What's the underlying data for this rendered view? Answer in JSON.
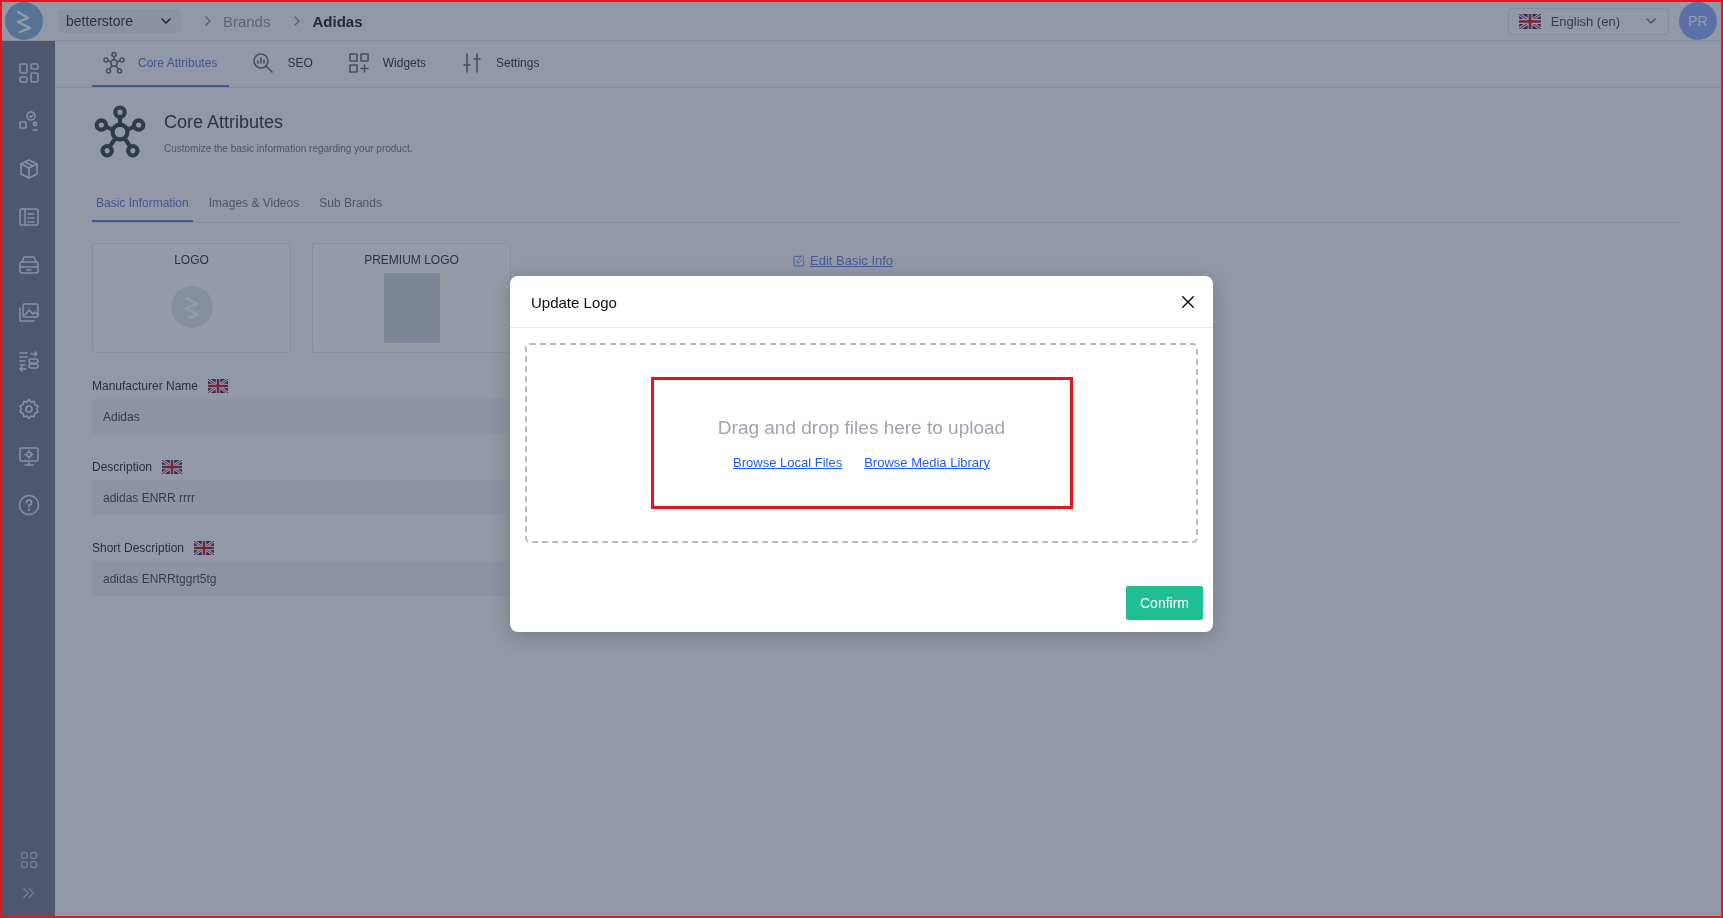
{
  "top_bar": {
    "store": "betterstore",
    "breadcrumb": [
      {
        "label": "Brands",
        "current": false
      },
      {
        "label": "Adidas",
        "current": true
      }
    ],
    "language": "English (en)",
    "avatar": "PR"
  },
  "tabs": [
    {
      "label": "Core Attributes",
      "selected": true
    },
    {
      "label": "SEO",
      "selected": false
    },
    {
      "label": "Widgets",
      "selected": false
    },
    {
      "label": "Settings",
      "selected": false
    }
  ],
  "section": {
    "title": "Core Attributes",
    "subtitle": "Customize the basic information regarding your product."
  },
  "sub_tabs": [
    {
      "label": "Basic Information",
      "selected": true
    },
    {
      "label": "Images & Videos",
      "selected": false
    },
    {
      "label": "Sub Brands",
      "selected": false
    }
  ],
  "logo_cards": [
    {
      "label": "LOGO",
      "kind": "logo"
    },
    {
      "label": "PREMIUM LOGO",
      "kind": "photo"
    }
  ],
  "edit_link": "Edit Basic Info",
  "fields": [
    {
      "label": "Manufacturer Name",
      "value": "Adidas"
    },
    {
      "label": "Description",
      "value": "adidas ENRR rrrr"
    },
    {
      "label": "Short Description",
      "value": "adidas ENRRtggrt5tg"
    }
  ],
  "modal": {
    "title": "Update Logo",
    "drop_text": "Drag and drop files here to upload",
    "links": [
      "Browse Local Files",
      "Browse Media Library"
    ],
    "confirm": "Confirm"
  }
}
